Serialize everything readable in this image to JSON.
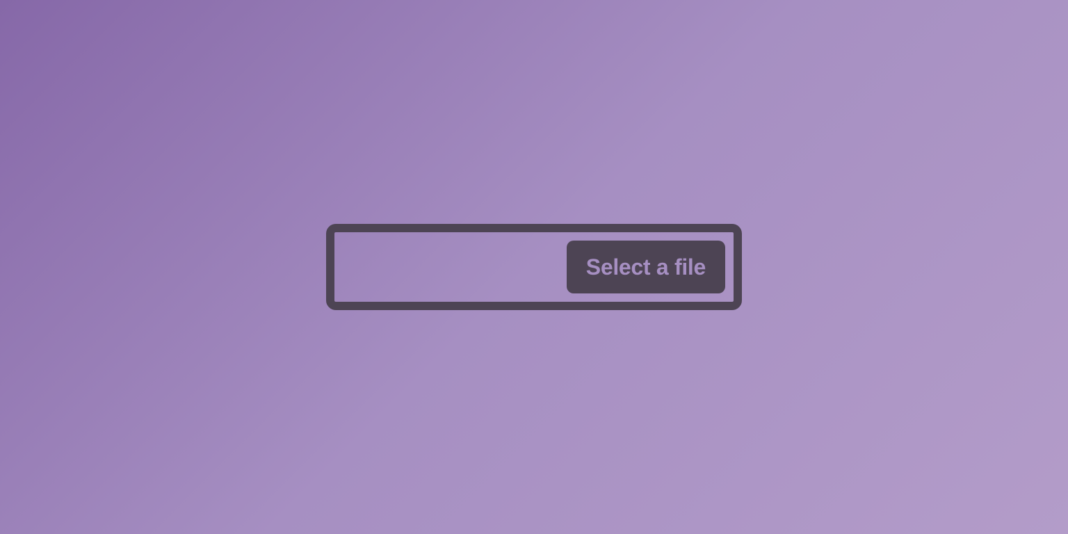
{
  "file_input": {
    "button_label": "Select a file",
    "selected_file": ""
  }
}
